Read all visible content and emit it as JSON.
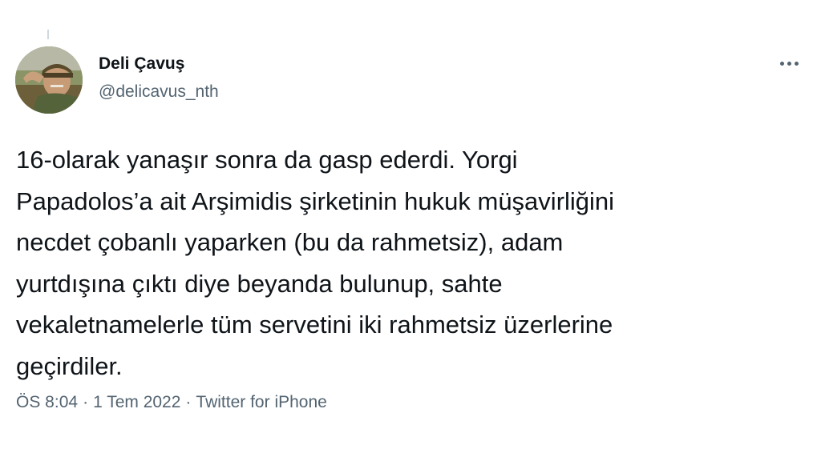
{
  "user": {
    "name": "Deli Çavuş",
    "handle": "@delicavus_nth"
  },
  "tweet": {
    "lines": [
      "16-olarak yanaşır sonra da gasp ederdi. Yorgi",
      "Papadolos’a ait Arşimidis şirketinin hukuk müşavirliğini",
      "necdet çobanlı yaparken (bu da rahmetsiz), adam",
      "yurtdışına çıktı diye beyanda bulunup, sahte",
      "vekaletnamelerle tüm servetini iki rahmetsiz üzerlerine",
      "geçirdiler."
    ]
  },
  "meta": {
    "time": "ÖS 8:04",
    "separator": "·",
    "date": "1 Tem 2022",
    "source": "Twitter for iPhone"
  },
  "icons": {
    "more": "more-horizontal-icon"
  },
  "colors": {
    "text": "#0f1419",
    "secondary": "#536471",
    "background": "#ffffff"
  }
}
